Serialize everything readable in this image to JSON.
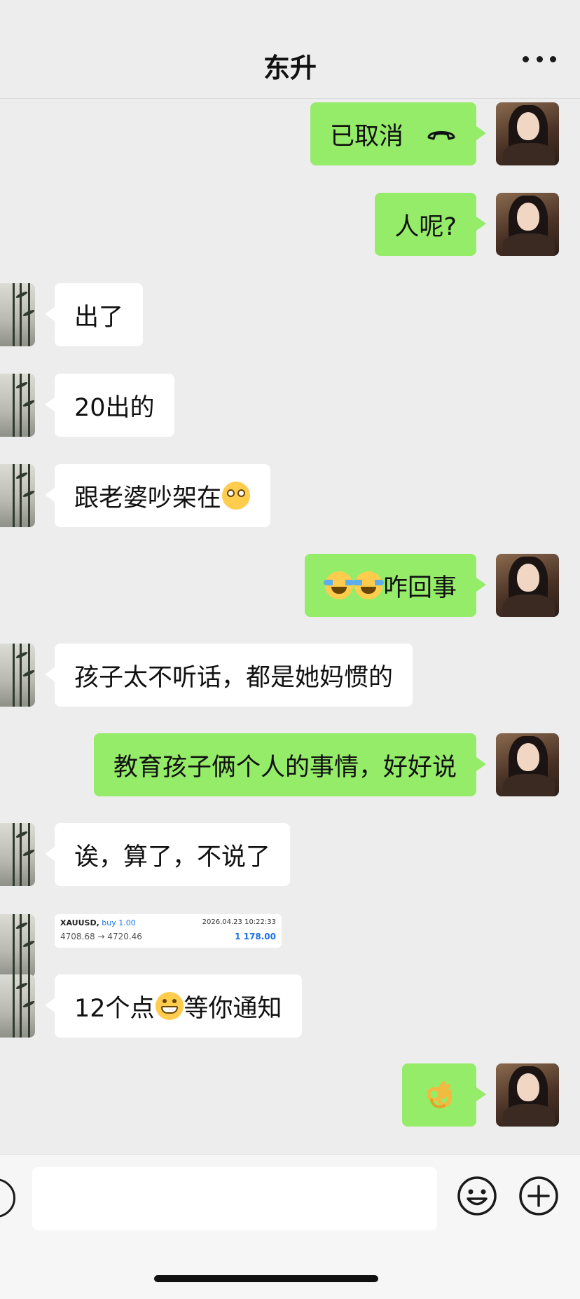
{
  "header": {
    "title": "东升"
  },
  "messages": [
    {
      "side": "mine",
      "text": "已取消",
      "type": "call"
    },
    {
      "side": "mine",
      "text": "人呢?"
    },
    {
      "side": "other",
      "text": "出了"
    },
    {
      "side": "other",
      "text": "20出的"
    },
    {
      "side": "other",
      "text": "跟老婆吵架在",
      "emoji": "flushed-face"
    },
    {
      "side": "mine",
      "text": "咋回事",
      "emoji": "loudly-crying-face"
    },
    {
      "side": "other",
      "text": "孩子太不听话，都是她妈惯的"
    },
    {
      "side": "mine",
      "text": "教育孩子俩个人的事情，好好说"
    },
    {
      "side": "other",
      "text": "诶，算了，不说了"
    },
    {
      "side": "other",
      "type": "trade-card"
    },
    {
      "side": "other",
      "text_before": "12个点",
      "text_after": "等你通知",
      "emoji": "grinning-face"
    },
    {
      "side": "mine",
      "emoji": "ok-hand"
    }
  ],
  "trade_card": {
    "symbol": "XAUUSD,",
    "action": "buy 1.00",
    "datetime": "2026.04.23 10:22:33",
    "prices": "4708.68 → 4720.46",
    "profit": "1 178.00"
  },
  "input": {
    "value": ""
  },
  "colors": {
    "mine_bubble": "#95ec69",
    "other_bubble": "#ffffff",
    "background": "#ededed"
  }
}
